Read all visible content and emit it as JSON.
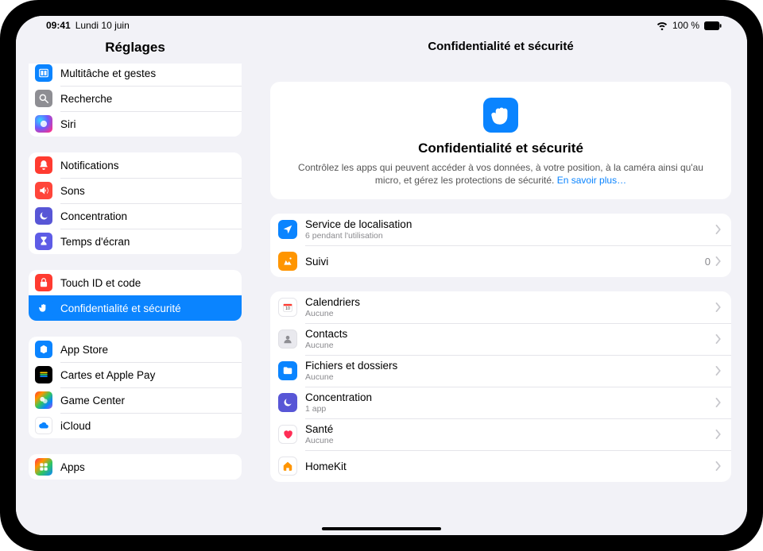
{
  "status": {
    "time": "09:41",
    "date": "Lundi 10 juin",
    "battery": "100 %"
  },
  "sidebar": {
    "title": "Réglages",
    "groups": [
      {
        "items": [
          {
            "label": "Multitâche et gestes",
            "icon": "multitask-icon",
            "bg": "bg-blue"
          },
          {
            "label": "Recherche",
            "icon": "search-icon",
            "bg": "bg-grey"
          },
          {
            "label": "Siri",
            "icon": "siri-icon",
            "bg": "bg-siri"
          }
        ],
        "partialTop": true
      },
      {
        "items": [
          {
            "label": "Notifications",
            "icon": "bell-icon",
            "bg": "bg-red"
          },
          {
            "label": "Sons",
            "icon": "speaker-icon",
            "bg": "bg-red2"
          },
          {
            "label": "Concentration",
            "icon": "moon-icon",
            "bg": "bg-purple"
          },
          {
            "label": "Temps d'écran",
            "icon": "hourglass-icon",
            "bg": "bg-indigo"
          }
        ]
      },
      {
        "items": [
          {
            "label": "Touch ID et code",
            "icon": "lock-icon",
            "bg": "bg-red"
          },
          {
            "label": "Confidentialité et sécurité",
            "icon": "hand-icon",
            "bg": "bg-blue",
            "selected": true
          }
        ]
      },
      {
        "items": [
          {
            "label": "App Store",
            "icon": "appstore-icon",
            "bg": "bg-blue"
          },
          {
            "label": "Cartes et Apple Pay",
            "icon": "wallet-icon",
            "bg": "bg-wallet"
          },
          {
            "label": "Game Center",
            "icon": "gamecenter-icon",
            "bg": "bg-gc"
          },
          {
            "label": "iCloud",
            "icon": "cloud-icon",
            "bg": "bg-cloud"
          }
        ]
      },
      {
        "items": [
          {
            "label": "Apps",
            "icon": "apps-icon",
            "bg": "bg-apps"
          }
        ]
      }
    ]
  },
  "main": {
    "title": "Confidentialité et sécurité",
    "hero": {
      "title": "Confidentialité et sécurité",
      "desc": "Contrôlez les apps qui peuvent accéder à vos données, à votre position, à la caméra ainsi qu'au micro, et gérez les protections de sécurité. ",
      "link": "En savoir plus…"
    },
    "section1": [
      {
        "label": "Service de localisation",
        "sub": "6 pendant l'utilisation",
        "icon": "location-icon",
        "bg": "bg-blue"
      },
      {
        "label": "Suivi",
        "value": "0",
        "icon": "tracking-icon",
        "bg": "bg-orange"
      }
    ],
    "section2": [
      {
        "label": "Calendriers",
        "sub": "Aucune",
        "icon": "calendar-icon",
        "bg": "bg-white"
      },
      {
        "label": "Contacts",
        "sub": "Aucune",
        "icon": "contacts-icon",
        "bg": "bg-lightgrey"
      },
      {
        "label": "Fichiers et dossiers",
        "sub": "Aucune",
        "icon": "folder-icon",
        "bg": "bg-folder"
      },
      {
        "label": "Concentration",
        "sub": "1 app",
        "icon": "moon-icon",
        "bg": "bg-purple"
      },
      {
        "label": "Santé",
        "sub": "Aucune",
        "icon": "heart-icon",
        "bg": "bg-health"
      },
      {
        "label": "HomeKit",
        "sub": "",
        "icon": "home-icon",
        "bg": "bg-home"
      }
    ]
  }
}
